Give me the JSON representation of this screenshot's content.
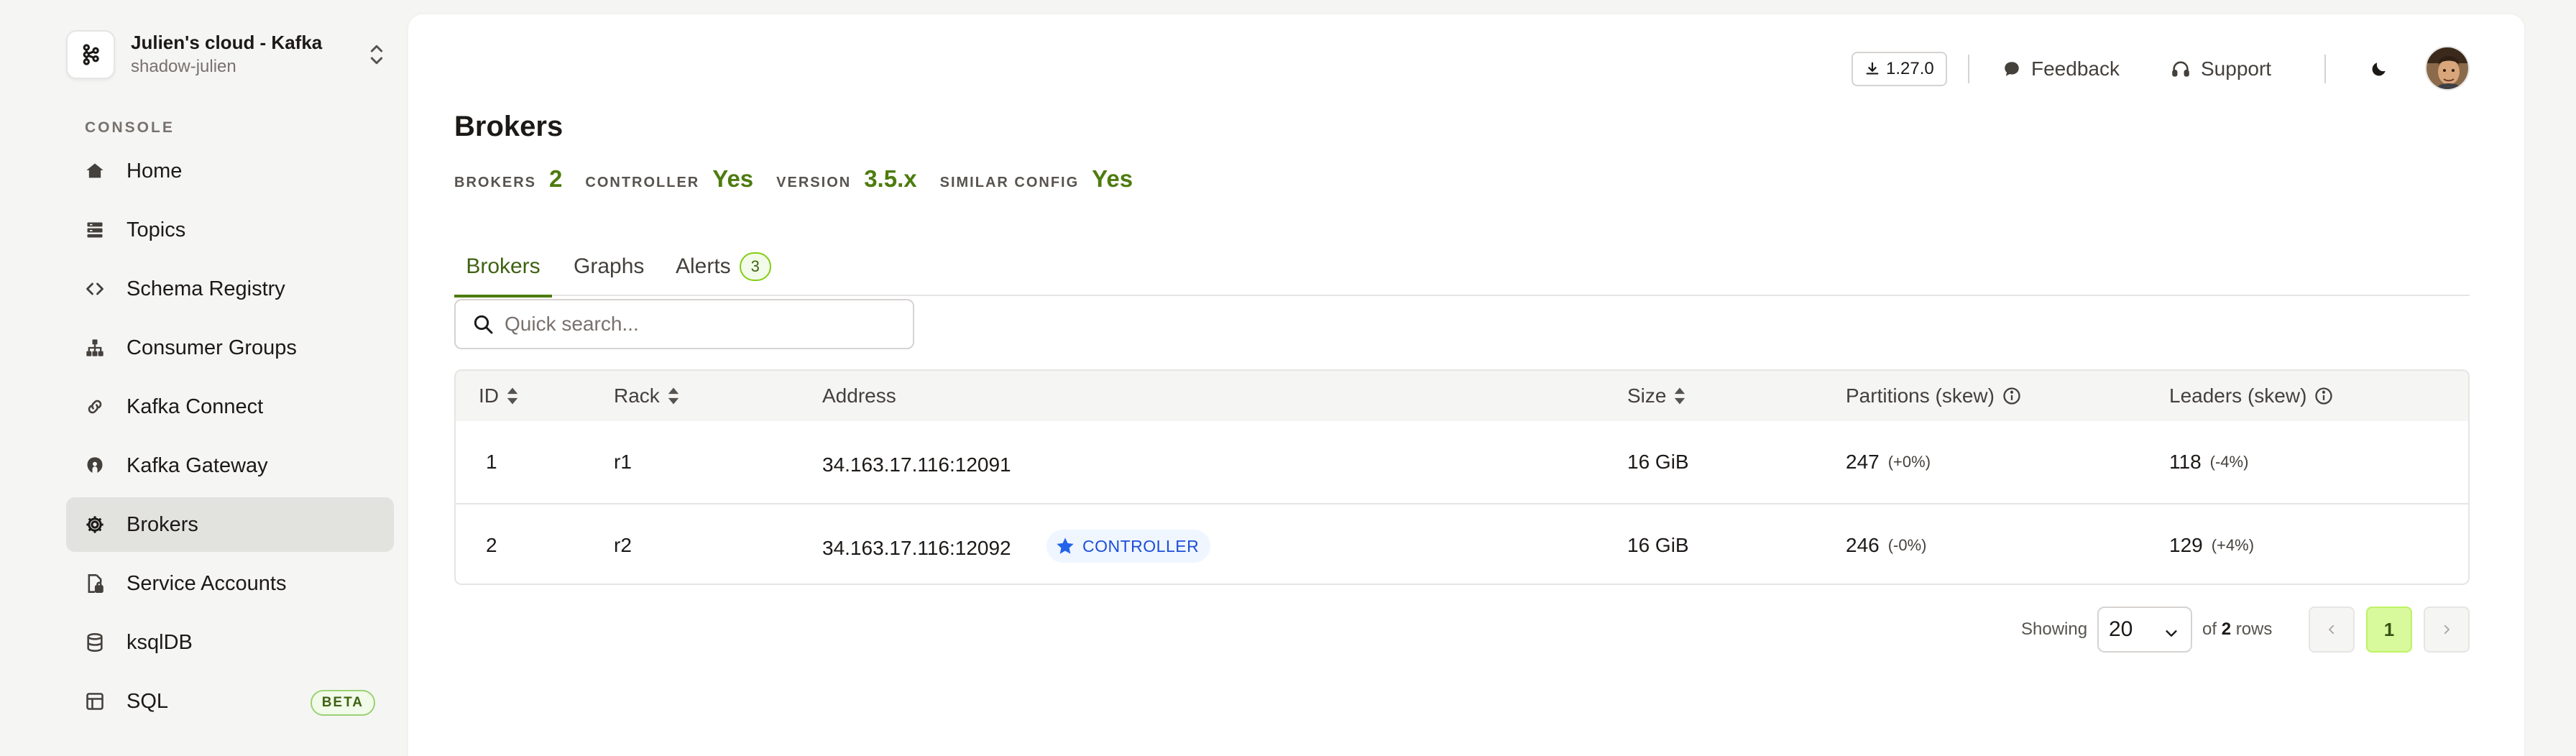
{
  "workspace": {
    "title": "Julien's cloud - Kafka",
    "subtitle": "shadow-julien"
  },
  "sidebar": {
    "section_label": "CONSOLE",
    "items": [
      {
        "label": "Home",
        "icon": "home-icon"
      },
      {
        "label": "Topics",
        "icon": "topics-icon"
      },
      {
        "label": "Schema Registry",
        "icon": "code-icon"
      },
      {
        "label": "Consumer Groups",
        "icon": "hierarchy-icon"
      },
      {
        "label": "Kafka Connect",
        "icon": "link-icon"
      },
      {
        "label": "Kafka Gateway",
        "icon": "gateway-icon"
      },
      {
        "label": "Brokers",
        "icon": "gear-icon",
        "active": true
      },
      {
        "label": "Service Accounts",
        "icon": "lock-file-icon"
      },
      {
        "label": "ksqlDB",
        "icon": "database-icon"
      },
      {
        "label": "SQL",
        "icon": "table-icon",
        "badge": "BETA"
      }
    ]
  },
  "topbar": {
    "version": "1.27.0",
    "feedback": "Feedback",
    "support": "Support"
  },
  "page": {
    "title": "Brokers",
    "stats": [
      {
        "label": "BROKERS",
        "value": "2"
      },
      {
        "label": "CONTROLLER",
        "value": "Yes"
      },
      {
        "label": "VERSION",
        "value": "3.5.x"
      },
      {
        "label": "SIMILAR CONFIG",
        "value": "Yes"
      }
    ],
    "tabs": [
      {
        "label": "Brokers",
        "active": true
      },
      {
        "label": "Graphs"
      },
      {
        "label": "Alerts",
        "count": "3"
      }
    ],
    "search_placeholder": "Quick search..."
  },
  "table": {
    "columns": [
      "ID",
      "Rack",
      "Address",
      "Size",
      "Partitions (skew)",
      "Leaders (skew)"
    ],
    "rows": [
      {
        "id": "1",
        "rack": "r1",
        "address": "34.163.17.116:12091",
        "controller": "",
        "size": "16 GiB",
        "partitions": "247",
        "partitions_skew": "(+0%)",
        "leaders": "118",
        "leaders_skew": "(-4%)"
      },
      {
        "id": "2",
        "rack": "r2",
        "address": "34.163.17.116:12092",
        "controller": "CONTROLLER",
        "size": "16 GiB",
        "partitions": "246",
        "partitions_skew": "(-0%)",
        "leaders": "129",
        "leaders_skew": "(+4%)"
      }
    ]
  },
  "pagination": {
    "showing_label": "Showing",
    "page_size": "20",
    "of_label": "of",
    "total_rows": "2",
    "rows_label": "rows",
    "current_page": "1"
  },
  "colors": {
    "accent": "#4d7c0f",
    "active_bg": "#e2e2df",
    "controller": "#1d4ed8"
  }
}
